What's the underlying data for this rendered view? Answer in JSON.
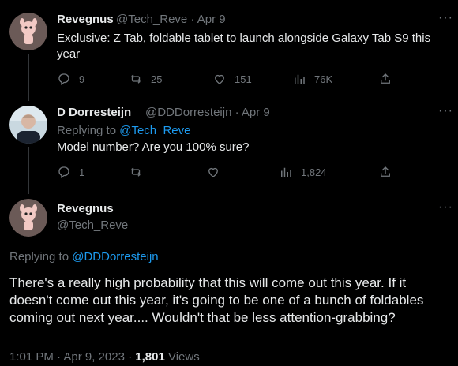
{
  "tweets": [
    {
      "name": "Revegnus",
      "handle_date": "@Tech_Reve · Apr 9",
      "text": "Exclusive: Z Tab, foldable tablet to launch alongside Galaxy Tab S9 this year",
      "replies": "9",
      "retweets": "25",
      "likes": "151",
      "views": "76K"
    },
    {
      "name": "D Dorresteijn",
      "handle_date": "@DDDorresteijn · Apr 9",
      "replying_prefix": "Replying to ",
      "replying_handle": "@Tech_Reve",
      "text": "Model number? Are you 100% sure?",
      "replies": "1",
      "views": "1,824"
    }
  ],
  "main_tweet": {
    "name": "Revegnus",
    "handle": "@Tech_Reve",
    "replying_prefix": "Replying to ",
    "replying_handle": "@DDDorresteijn",
    "text": "There's a really high probability that this will come out this year. If it doesn't come out this year, it's going to be one of a bunch of foldables coming out next year.... Wouldn't that be less attention-grabbing?",
    "timestamp": "1:01 PM · Apr 9, 2023 · ",
    "views_count": "1,801",
    "views_label": " Views"
  },
  "more_label": "···",
  "colors": {
    "background": "#000000",
    "text": "#e7e9ea",
    "muted": "#71767b",
    "link": "#1d9bf0",
    "line": "#333639"
  },
  "icons": [
    "reply-icon",
    "retweet-icon",
    "like-icon",
    "views-icon",
    "share-icon",
    "more-icon"
  ]
}
